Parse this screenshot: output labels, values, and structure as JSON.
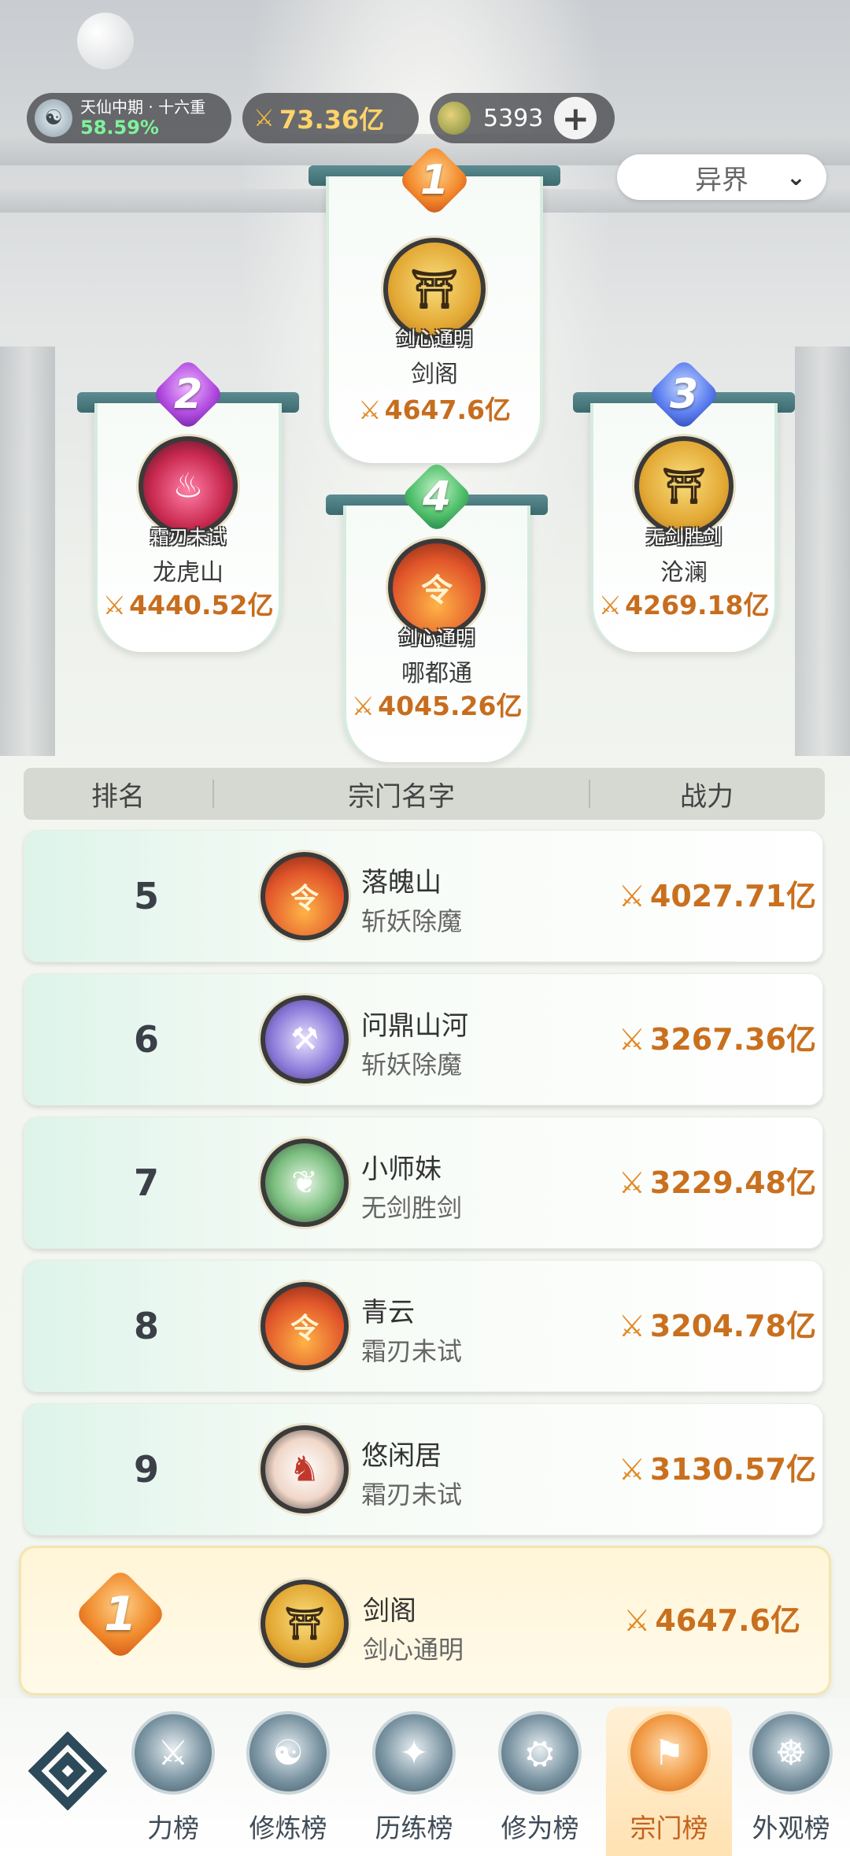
{
  "status": {
    "realm": "天仙中期 · 十六重",
    "realm_progress": "58.59%",
    "total_power": "73.36亿",
    "spirit_stones": "5393"
  },
  "region_select": {
    "value": "异界"
  },
  "podium": [
    {
      "rank": "1",
      "tag": "剑心通明",
      "name": "剑阁",
      "power": "4647.6亿",
      "emblem": "pavilion-emblem-icon"
    },
    {
      "rank": "2",
      "tag": "霜刃未试",
      "name": "龙虎山",
      "power": "4440.52亿",
      "emblem": "flame-emblem-icon"
    },
    {
      "rank": "3",
      "tag": "无剑胜剑",
      "name": "沧澜",
      "power": "4269.18亿",
      "emblem": "pavilion-emblem-icon"
    },
    {
      "rank": "4",
      "tag": "剑心通明",
      "name": "哪都通",
      "power": "4045.26亿",
      "emblem": "seal-flame-emblem-icon"
    }
  ],
  "table": {
    "headers": [
      "排名",
      "宗门名字",
      "战力"
    ],
    "rows": [
      {
        "rank": "5",
        "name": "落魄山",
        "tag": "斩妖除魔",
        "power": "4027.71亿",
        "emblem": "seal-flame-emblem-icon"
      },
      {
        "rank": "6",
        "name": "问鼎山河",
        "tag": "斩妖除魔",
        "power": "3267.36亿",
        "emblem": "axe-emblem-icon"
      },
      {
        "rank": "7",
        "name": "小师妹",
        "tag": "无剑胜剑",
        "power": "3229.48亿",
        "emblem": "leaf-emblem-icon"
      },
      {
        "rank": "8",
        "name": "青云",
        "tag": "霜刃未试",
        "power": "3204.78亿",
        "emblem": "seal-flame-emblem-icon"
      },
      {
        "rank": "9",
        "name": "悠闲居",
        "tag": "霜刃未试",
        "power": "3130.57亿",
        "emblem": "horse-emblem-icon"
      }
    ]
  },
  "my_sect": {
    "rank": "1",
    "name": "剑阁",
    "tag": "剑心通明",
    "power": "4647.6亿"
  },
  "nav": {
    "tabs": [
      {
        "label": "力榜"
      },
      {
        "label": "修炼榜"
      },
      {
        "label": "历练榜"
      },
      {
        "label": "修为榜"
      },
      {
        "label": "宗门榜"
      },
      {
        "label": "外观榜"
      }
    ],
    "active_tab": "宗门榜"
  },
  "colors": {
    "accent_orange": "#c9701e",
    "realm_green": "#7ff29a",
    "banner_teal": "#4a7c81"
  }
}
